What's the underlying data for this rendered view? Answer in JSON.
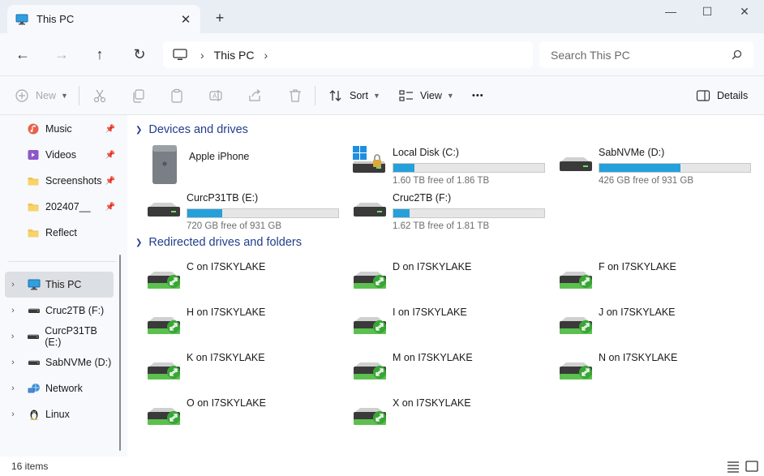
{
  "tab": {
    "title": "This PC",
    "close": "✕",
    "new_tab": "+"
  },
  "window": {
    "minimize": "—",
    "maximize": "☐",
    "close": "✕"
  },
  "nav": {
    "back": "←",
    "forward": "→",
    "up": "↑",
    "refresh": "↻"
  },
  "address": {
    "crumb": "This PC",
    "chevron": "›"
  },
  "search": {
    "placeholder": "Search This PC"
  },
  "toolbar": {
    "new_label": "New",
    "sort_label": "Sort",
    "view_label": "View",
    "more_label": "•••",
    "details_label": "Details"
  },
  "sidebar": {
    "quick": [
      {
        "label": "Music",
        "icon": "music-icon"
      },
      {
        "label": "Videos",
        "icon": "videos-icon"
      },
      {
        "label": "Screenshots",
        "icon": "folder-icon"
      },
      {
        "label": "202407__",
        "icon": "folder-icon"
      },
      {
        "label": "Reflect",
        "icon": "folder-icon"
      }
    ],
    "tree": [
      {
        "label": "This PC",
        "icon": "pc-icon",
        "selected": true
      },
      {
        "label": "Cruc2TB (F:)",
        "icon": "drive-icon"
      },
      {
        "label": "CurcP31TB (E:)",
        "icon": "drive-icon"
      },
      {
        "label": "SabNVMe (D:)",
        "icon": "drive-icon"
      },
      {
        "label": "Network",
        "icon": "network-icon"
      },
      {
        "label": "Linux",
        "icon": "linux-icon"
      }
    ]
  },
  "groups": {
    "devices": "Devices and drives",
    "redirected": "Redirected drives and folders"
  },
  "devices": [
    {
      "name": "Apple iPhone",
      "icon": "phone-icon"
    },
    {
      "name": "Local Disk (C:)",
      "free": "1.60 TB free of 1.86 TB",
      "used_fraction": 0.14,
      "icon": "system-drive-icon"
    },
    {
      "name": "SabNVMe (D:)",
      "free": "426 GB free of 931 GB",
      "used_fraction": 0.54,
      "icon": "drive-icon"
    },
    {
      "name": "CurcP31TB (E:)",
      "free": "720 GB free of 931 GB",
      "used_fraction": 0.23,
      "icon": "drive-icon"
    },
    {
      "name": "Cruc2TB (F:)",
      "free": "1.62 TB free of 1.81 TB",
      "used_fraction": 0.11,
      "icon": "drive-icon"
    }
  ],
  "redirected": [
    {
      "name": "C on I7SKYLAKE"
    },
    {
      "name": "D on I7SKYLAKE"
    },
    {
      "name": "F on I7SKYLAKE"
    },
    {
      "name": "H on I7SKYLAKE"
    },
    {
      "name": "I on I7SKYLAKE"
    },
    {
      "name": "J on I7SKYLAKE"
    },
    {
      "name": "K on I7SKYLAKE"
    },
    {
      "name": "M on I7SKYLAKE"
    },
    {
      "name": "N on I7SKYLAKE"
    },
    {
      "name": "O on I7SKYLAKE"
    },
    {
      "name": "X on I7SKYLAKE"
    }
  ],
  "status": {
    "count": "16 items"
  },
  "colors": {
    "accent": "#26a0da",
    "group_heading": "#1f3e8c",
    "chrome": "#f7f9fc"
  }
}
